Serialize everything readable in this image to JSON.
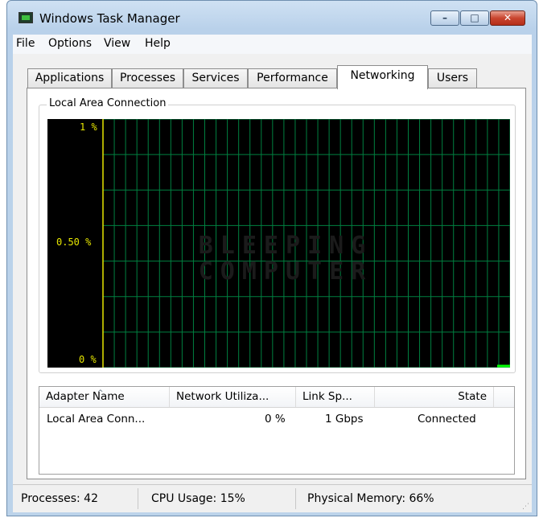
{
  "window": {
    "title": "Windows Task Manager",
    "icon": "task-manager-icon",
    "controls": {
      "minimize": "–",
      "maximize": "□",
      "close": "✕"
    }
  },
  "menu": [
    "File",
    "Options",
    "View",
    "Help"
  ],
  "tabs": [
    {
      "label": "Applications",
      "active": false
    },
    {
      "label": "Processes",
      "active": false
    },
    {
      "label": "Services",
      "active": false
    },
    {
      "label": "Performance",
      "active": false
    },
    {
      "label": "Networking",
      "active": true
    },
    {
      "label": "Users",
      "active": false
    }
  ],
  "network_graph": {
    "group_label": "Local Area Connection",
    "y_labels": {
      "top": "1 %",
      "mid": "0.50 %",
      "bottom": "0 %"
    },
    "watermark": [
      "BLEEPING",
      "COMPUTER"
    ],
    "colors": {
      "background": "#000000",
      "grid": "#008040",
      "axis": "#e6e600",
      "trace": "#00ff00"
    },
    "current_value_percent": 0
  },
  "adapters": {
    "columns": [
      "Adapter Name",
      "Network Utiliza...",
      "Link Sp...",
      "State"
    ],
    "rows": [
      {
        "name": "Local Area Conn...",
        "utilization": "0 %",
        "link_speed": "1 Gbps",
        "state": "Connected"
      }
    ]
  },
  "status": {
    "processes": "Processes: 42",
    "cpu": "CPU Usage: 15%",
    "memory": "Physical Memory: 66%"
  }
}
